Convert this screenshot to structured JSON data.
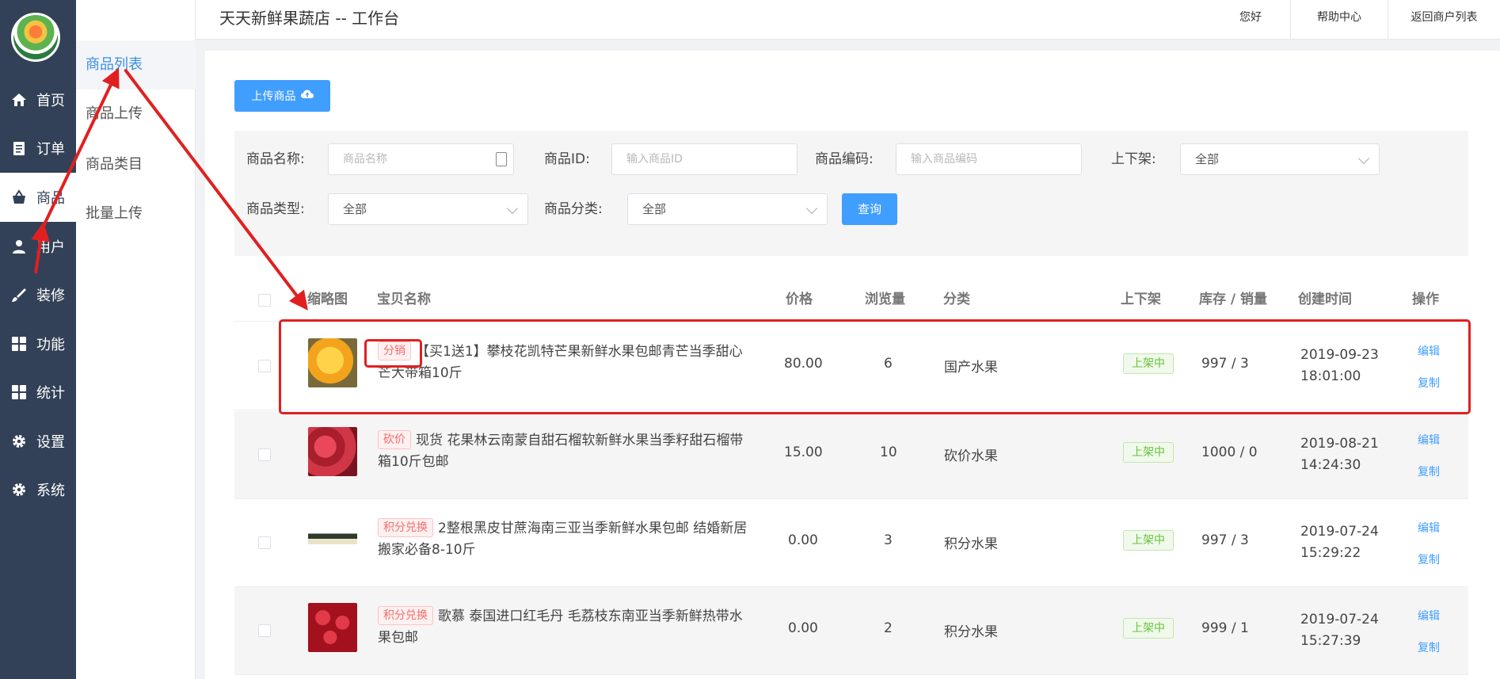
{
  "nav": {
    "items": [
      {
        "label": "首页",
        "icon": "home-icon"
      },
      {
        "label": "订单",
        "icon": "clipboard-icon"
      },
      {
        "label": "商品",
        "icon": "basket-icon"
      },
      {
        "label": "用户",
        "icon": "user-icon"
      },
      {
        "label": "装修",
        "icon": "brush-icon"
      },
      {
        "label": "功能",
        "icon": "grid-icon"
      },
      {
        "label": "统计",
        "icon": "grid-icon"
      },
      {
        "label": "设置",
        "icon": "gear-icon"
      },
      {
        "label": "系统",
        "icon": "gear-icon"
      }
    ]
  },
  "subnav": {
    "items": [
      "商品列表",
      "商品上传",
      "商品类目",
      "批量上传"
    ]
  },
  "header": {
    "title": "天天新鲜果蔬店 -- 工作台",
    "links": [
      "您好",
      "帮助中心",
      "返回商户列表"
    ]
  },
  "toolbar": {
    "upload_label": "上传商品"
  },
  "filter": {
    "name_label": "商品名称:",
    "name_placeholder": "商品名称",
    "id_label": "商品ID:",
    "id_placeholder": "输入商品ID",
    "code_label": "商品编码:",
    "code_placeholder": "输入商品编码",
    "shelf_label": "上下架:",
    "shelf_value": "全部",
    "type_label": "商品类型:",
    "type_value": "全部",
    "category_label": "商品分类:",
    "category_value": "全部",
    "query_label": "查询"
  },
  "table": {
    "columns": [
      "缩略图",
      "宝贝名称",
      "价格",
      "浏览量",
      "分类",
      "上下架",
      "库存 / 销量",
      "创建时间",
      "操作"
    ],
    "edit_label": "编辑",
    "copy_label": "复制",
    "rows": [
      {
        "tag": "分销",
        "name": "【买1送1】攀枝花凯特芒果新鲜水果包邮青芒当季甜心芒大带箱10斤",
        "price": "80.00",
        "views": "6",
        "category": "国产水果",
        "status": "上架中",
        "stock_sales": "997 / 3",
        "date": "2019-09-23",
        "time": "18:01:00",
        "thumb_color": "#f3a41c"
      },
      {
        "tag": "砍价",
        "name": "现货 花果林云南蒙自甜石榴软新鲜水果当季籽甜石榴带箱10斤包邮",
        "price": "15.00",
        "views": "10",
        "category": "砍价水果",
        "status": "上架中",
        "stock_sales": "1000 / 0",
        "date": "2019-08-21",
        "time": "14:24:30",
        "thumb_color": "#c8293a"
      },
      {
        "tag": "积分兑换",
        "name": "2整根黑皮甘蔗海南三亚当季新鲜水果包邮 结婚新居搬家必备8-10斤",
        "price": "0.00",
        "views": "3",
        "category": "积分水果",
        "status": "上架中",
        "stock_sales": "997 / 3",
        "date": "2019-07-24",
        "time": "15:29:22",
        "thumb_color": "#e9e2c6"
      },
      {
        "tag": "积分兑换",
        "name": "歌慕 泰国进口红毛丹 毛荔枝东南亚当季新鲜热带水果包邮",
        "price": "0.00",
        "views": "2",
        "category": "积分水果",
        "status": "上架中",
        "stock_sales": "999 / 1",
        "date": "2019-07-24",
        "time": "15:27:39",
        "thumb_color": "#c81f2e"
      }
    ]
  },
  "colors": {
    "accent": "#409eff",
    "nav_bg": "#324157",
    "annotation": "#e02020"
  }
}
